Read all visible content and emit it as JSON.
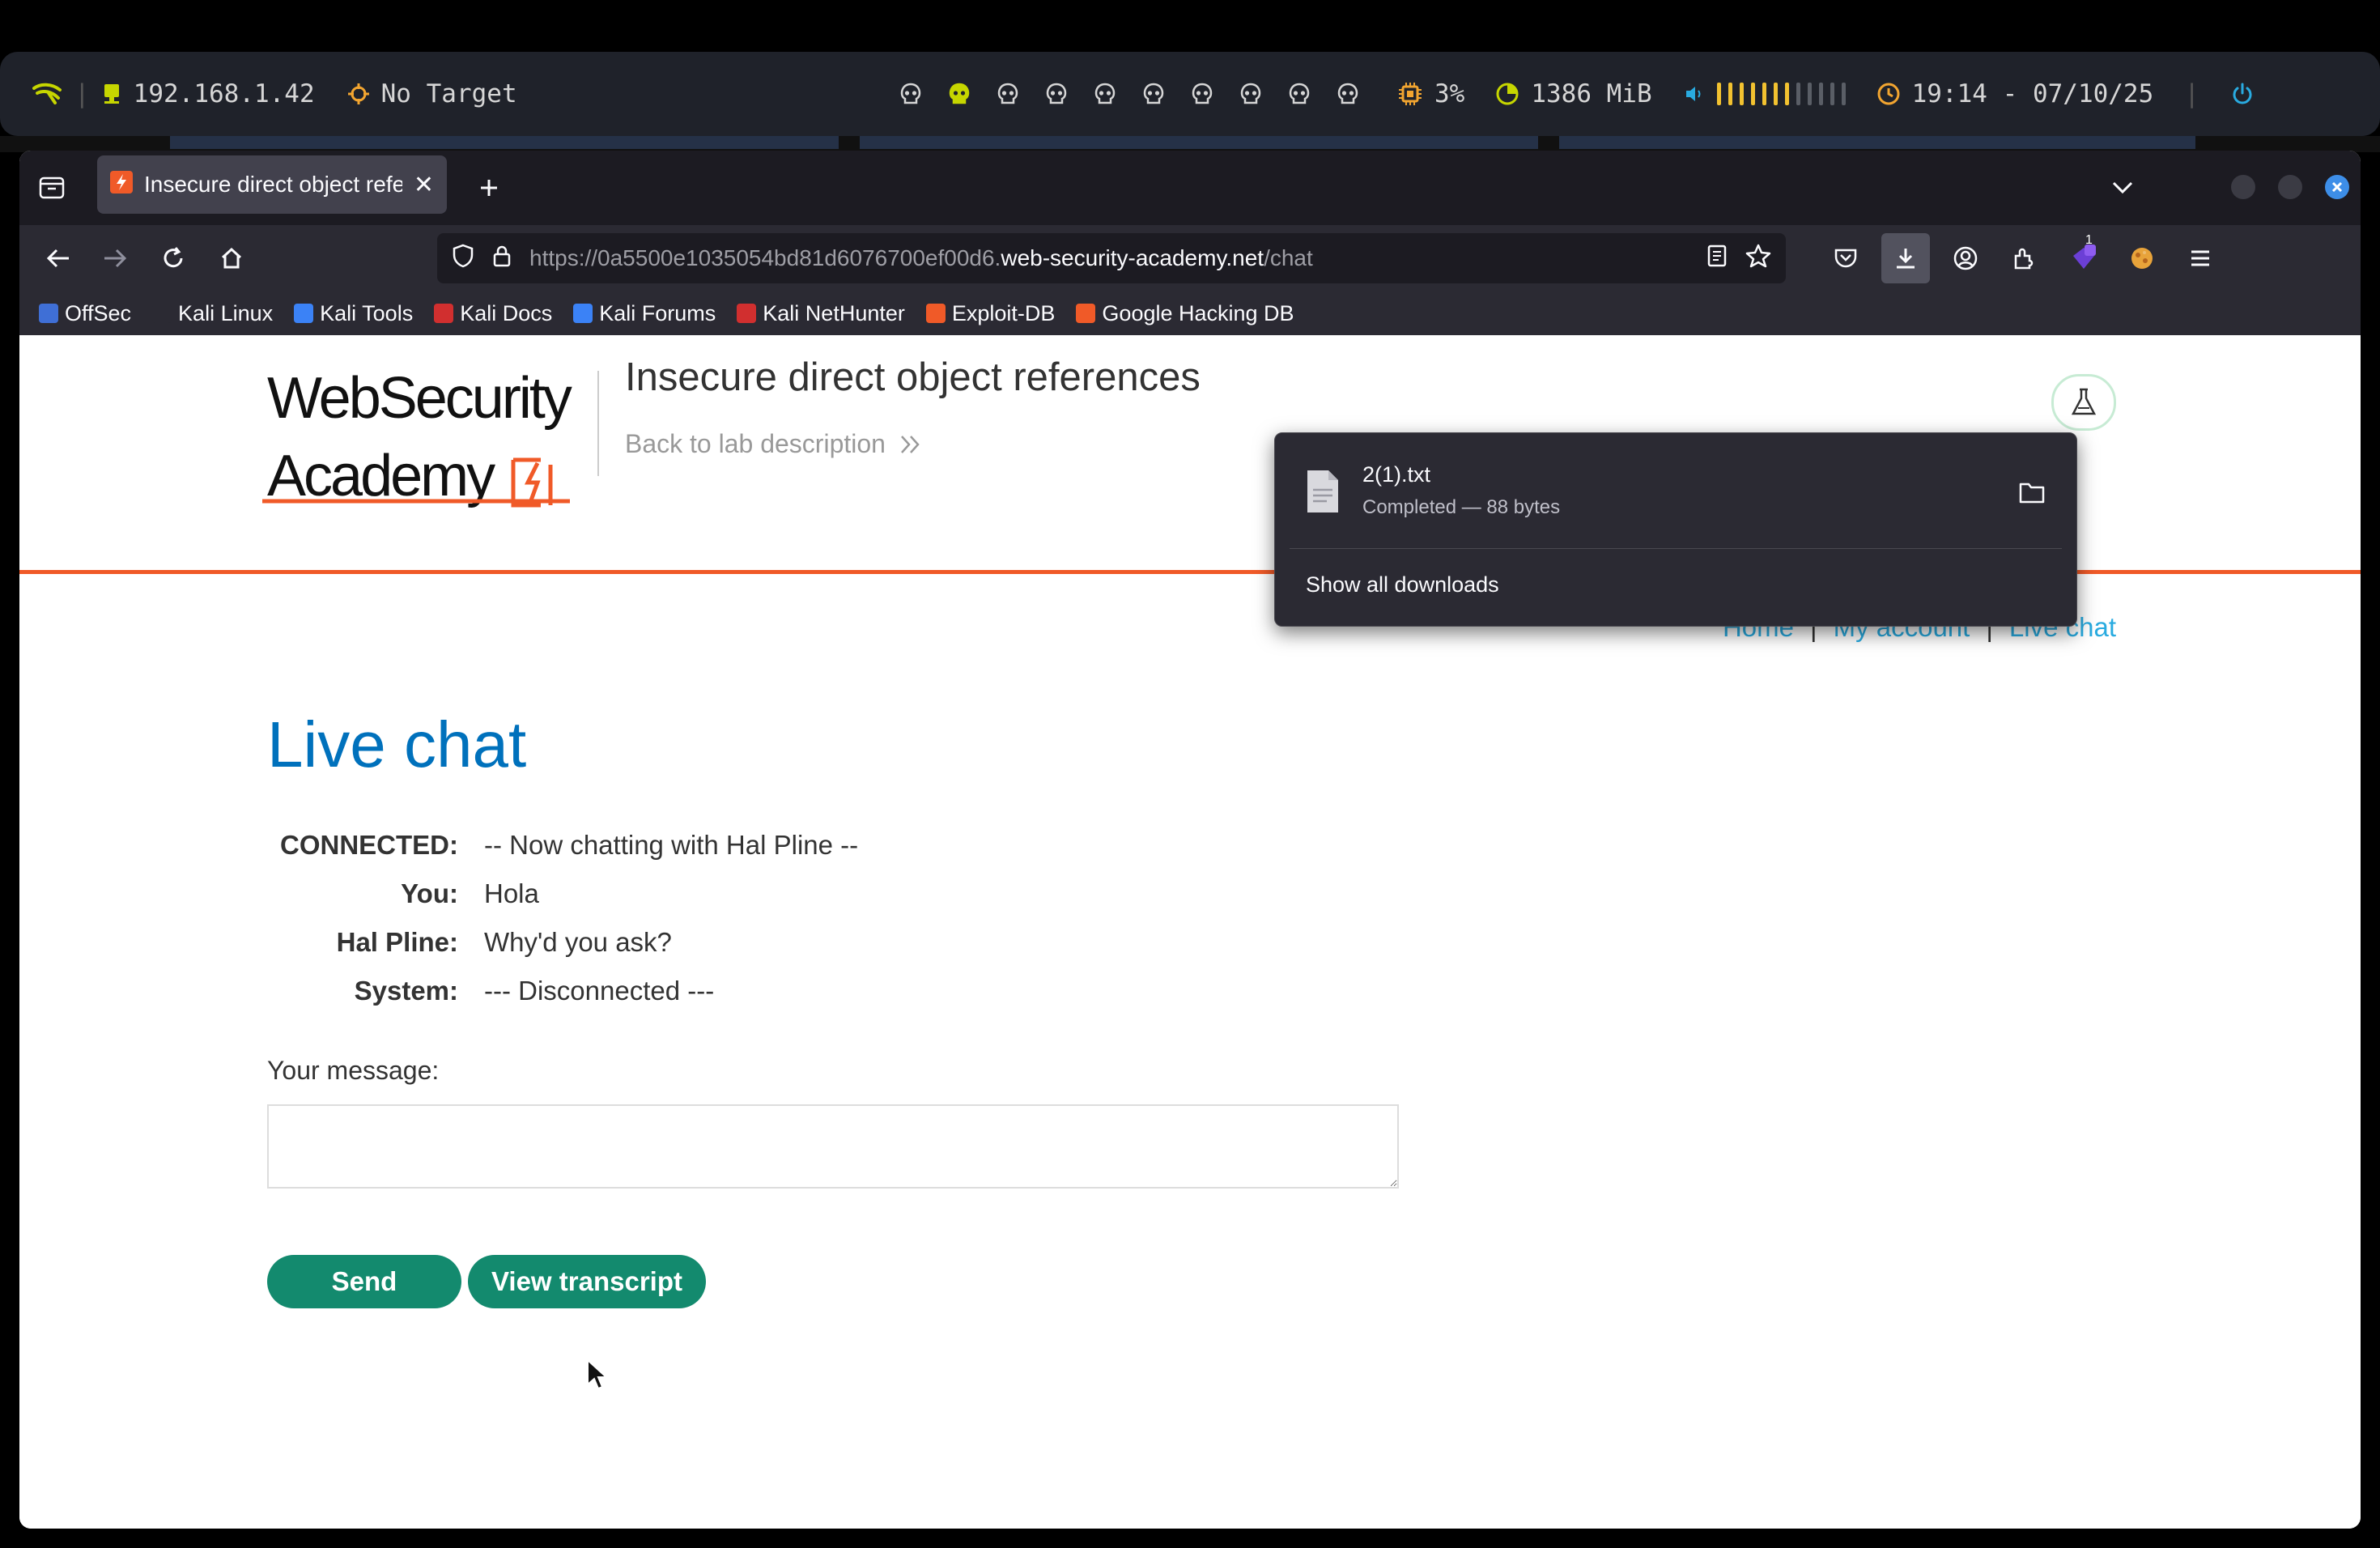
{
  "statusbar": {
    "ip": "192.168.1.42",
    "target": "No Target",
    "workspace_count": 10,
    "active_workspace": 2,
    "cpu": "3%",
    "memory": "1386 MiB",
    "volume_level": 0.6,
    "clock": "19:14 - 07/10/25",
    "colors": {
      "accent": "#f2c230",
      "ip_icon": "#c6d600",
      "power": "#29abe0"
    }
  },
  "browser": {
    "tab_title": "Insecure direct object references",
    "url_prefix": "https://0a5500e1035054bd81d6076700ef00d6.",
    "url_domain": "web-security-academy.net",
    "url_path": "/chat",
    "download_badge": "1",
    "bookmarks": [
      {
        "label": "OffSec",
        "icon": "offsec-icon",
        "color": "#3f6fd6"
      },
      {
        "label": "Kali Linux",
        "icon": "kali-dragon-icon",
        "color": "#2b2a33"
      },
      {
        "label": "Kali Tools",
        "icon": "kali-tools-icon",
        "color": "#3b82f6"
      },
      {
        "label": "Kali Docs",
        "icon": "kali-docs-icon",
        "color": "#d12f2f"
      },
      {
        "label": "Kali Forums",
        "icon": "kali-forums-icon",
        "color": "#3b82f6"
      },
      {
        "label": "Kali NetHunter",
        "icon": "nethunter-icon",
        "color": "#d12f2f"
      },
      {
        "label": "Exploit-DB",
        "icon": "exploit-db-icon",
        "color": "#f05a28"
      },
      {
        "label": "Google Hacking DB",
        "icon": "ghdb-icon",
        "color": "#f05a28"
      }
    ]
  },
  "downloads": {
    "file_name": "2(1).txt",
    "status": "Completed — 88 bytes",
    "show_all": "Show all downloads"
  },
  "page": {
    "logo_line1": "WebSecurity",
    "logo_line2": "Academy",
    "lab_title": "Insecure direct object references",
    "back_link": "Back to lab description",
    "nav": {
      "home": "Home",
      "account": "My account",
      "chat": "Live chat",
      "separator": "|"
    },
    "heading": "Live chat",
    "messages": [
      {
        "who": "CONNECTED:",
        "text": "-- Now chatting with Hal Pline --"
      },
      {
        "who": "You:",
        "text": "Hola"
      },
      {
        "who": "Hal Pline:",
        "text": "Why'd you ask?"
      },
      {
        "who": "System:",
        "text": "--- Disconnected ---"
      }
    ],
    "message_label": "Your message:",
    "message_value": "",
    "send_label": "Send",
    "transcript_label": "View transcript",
    "colors": {
      "brand_orange": "#f05a28",
      "heading_blue": "#0071bc",
      "link_blue": "#29abe0",
      "button_green": "#138a6e"
    }
  }
}
